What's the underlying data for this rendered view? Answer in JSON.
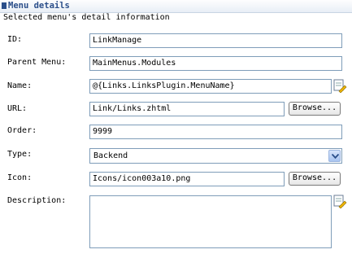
{
  "header": {
    "title": "Menu details",
    "subtitle": "Selected menu's detail information"
  },
  "form": {
    "id": {
      "label": "ID:",
      "value": "LinkManage"
    },
    "parent_menu": {
      "label": "Parent Menu:",
      "value": "MainMenus.Modules"
    },
    "name": {
      "label": "Name:",
      "value": "@{Links.LinksPlugin.MenuName}",
      "icon": "edit-resource-icon"
    },
    "url": {
      "label": "URL:",
      "value": "Link/Links.zhtml",
      "browse_label": "Browse..."
    },
    "order": {
      "label": "Order:",
      "value": "9999"
    },
    "type": {
      "label": "Type:",
      "selected": "Backend"
    },
    "icon": {
      "label": "Icon:",
      "value": "Icons/icon003a10.png",
      "browse_label": "Browse..."
    },
    "description": {
      "label": "Description:",
      "value": "",
      "icon": "edit-resource-icon"
    }
  },
  "colors": {
    "accent": "#2b4f8a",
    "field_border": "#7f9db9"
  }
}
